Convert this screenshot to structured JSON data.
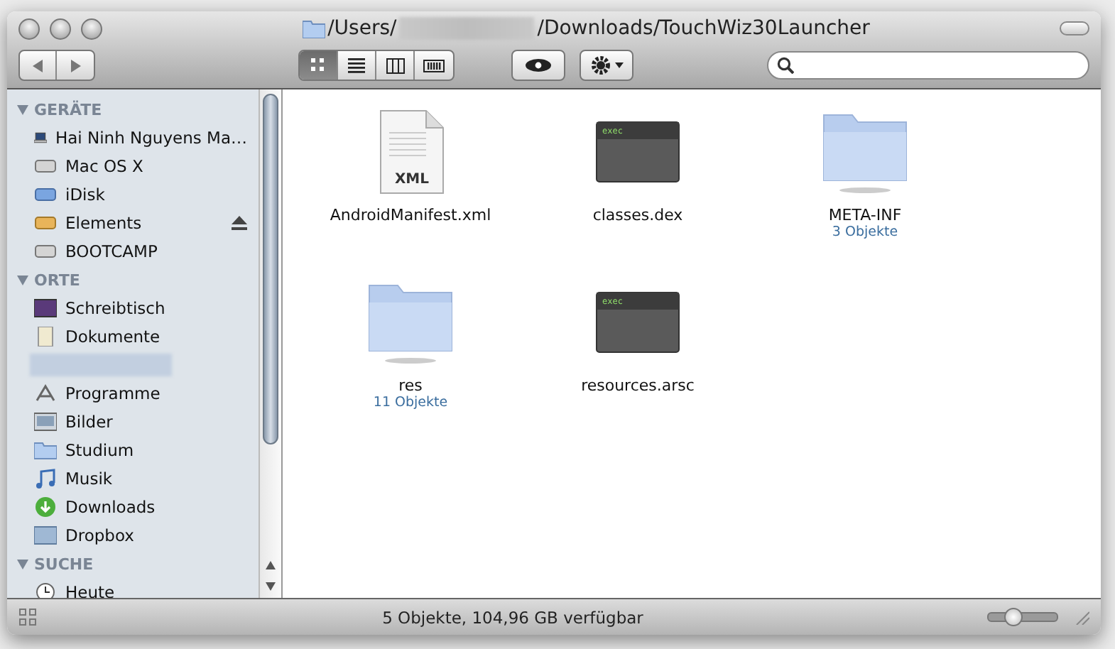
{
  "window": {
    "title_before": "/Users/",
    "title_after": "/Downloads/TouchWiz30Launcher"
  },
  "toolbar": {
    "view_modes": [
      {
        "kind": "icons",
        "selected": true
      },
      {
        "kind": "list",
        "selected": false
      },
      {
        "kind": "columns",
        "selected": false
      },
      {
        "kind": "coverflow",
        "selected": false
      }
    ]
  },
  "sidebar": {
    "sections": [
      {
        "title": "GERÄTE",
        "items": [
          {
            "kind": "laptop",
            "label": "Hai Ninh Nguyens Ma…",
            "eject": false
          },
          {
            "kind": "disk",
            "label": "Mac OS X",
            "eject": false
          },
          {
            "kind": "idisk",
            "label": "iDisk",
            "eject": false
          },
          {
            "kind": "external",
            "label": "Elements",
            "eject": true
          },
          {
            "kind": "disk",
            "label": "BOOTCAMP",
            "eject": false
          }
        ]
      },
      {
        "title": "ORTE",
        "items": [
          {
            "kind": "desktop",
            "label": "Schreibtisch",
            "eject": false
          },
          {
            "kind": "document",
            "label": "Dokumente",
            "eject": false
          },
          {
            "kind": "redacted"
          },
          {
            "kind": "apps",
            "label": "Programme",
            "eject": false
          },
          {
            "kind": "pictures",
            "label": "Bilder",
            "eject": false
          },
          {
            "kind": "folder",
            "label": "Studium",
            "eject": false
          },
          {
            "kind": "music",
            "label": "Musik",
            "eject": false
          },
          {
            "kind": "downloads",
            "label": "Downloads",
            "eject": false
          },
          {
            "kind": "dropbox",
            "label": "Dropbox",
            "eject": false
          }
        ]
      },
      {
        "title": "SUCHE",
        "items": [
          {
            "kind": "clock",
            "label": "Heute",
            "eject": false
          }
        ]
      }
    ]
  },
  "files": [
    {
      "kind": "xml",
      "name": "AndroidManifest.xml",
      "badge": "XML"
    },
    {
      "kind": "exec",
      "name": "classes.dex",
      "badge": "exec"
    },
    {
      "kind": "folder",
      "name": "META-INF",
      "count": "3 Objekte"
    },
    {
      "kind": "folder",
      "name": "res",
      "count": "11 Objekte"
    },
    {
      "kind": "exec",
      "name": "resources.arsc",
      "badge": "exec"
    }
  ],
  "status_bar": {
    "text": "5 Objekte, 104,96 GB verfügbar",
    "zoom": {
      "level": 0.35
    }
  }
}
